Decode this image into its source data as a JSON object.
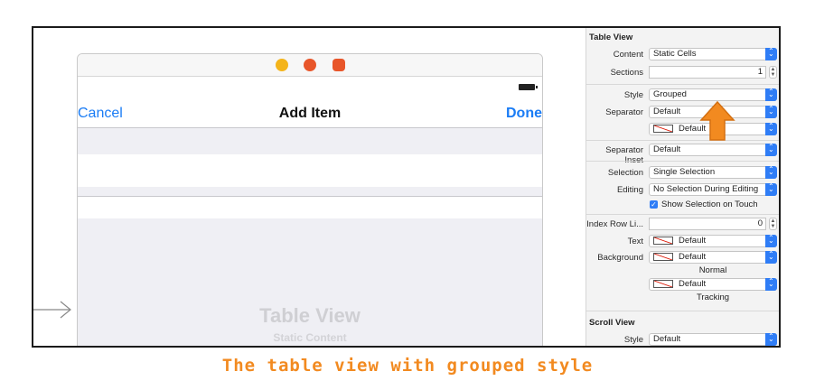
{
  "scene": {
    "nav_cancel": "Cancel",
    "nav_title": "Add Item",
    "nav_done": "Done",
    "placeholder_title": "Table View",
    "placeholder_subtitle": "Static Content"
  },
  "inspector": {
    "table_view_title": "Table View",
    "content_label": "Content",
    "content_value": "Static Cells",
    "sections_label": "Sections",
    "sections_value": "1",
    "style_label": "Style",
    "style_value": "Grouped",
    "separator_label": "Separator",
    "separator_value": "Default",
    "separator_color_value": "Default",
    "separator_inset_label": "Separator Inset",
    "separator_inset_value": "Default",
    "selection_label": "Selection",
    "selection_value": "Single Selection",
    "editing_label": "Editing",
    "editing_value": "No Selection During Editing",
    "show_selection_label": "Show Selection on Touch",
    "index_row_label": "Index Row Li...",
    "index_row_value": "0",
    "text_label": "Text",
    "text_value": "Default",
    "background_label": "Background",
    "background_value": "Default",
    "normal_caption": "Normal",
    "tracking_value": "Default",
    "tracking_caption": "Tracking",
    "scroll_view_title": "Scroll View",
    "scroll_style_label": "Style",
    "scroll_style_value": "Default"
  },
  "caption": "The table view with grouped style",
  "colors": {
    "accent": "#2f7df6",
    "ios_blue": "#1a7cf5",
    "annotation_orange": "#f28a20",
    "group_bg": "#efeff4"
  }
}
